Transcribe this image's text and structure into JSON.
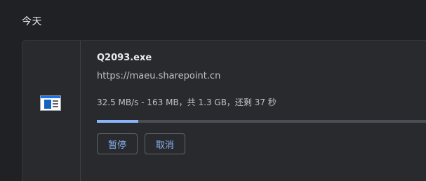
{
  "section": {
    "title": "今天"
  },
  "download": {
    "file_name": "Q2093.exe",
    "url": "https://maeu.sharepoint.cn",
    "status": "32.5 MB/s - 163 MB，共 1.3 GB，还剩 37 秒",
    "progress_fraction": 0.125,
    "icon": "exe-file-icon",
    "pause_label": "暂停",
    "cancel_label": "取消"
  },
  "colors": {
    "accent": "#8ab4f8",
    "background": "#202124",
    "card": "#292a2d"
  }
}
